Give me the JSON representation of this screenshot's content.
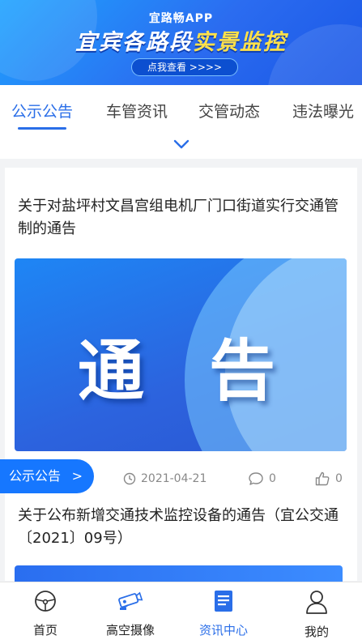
{
  "banner": {
    "app_name": "宜路畅APP",
    "title_prefix": "宜宾各路段",
    "title_highlight": "实景监控",
    "button_label": "点我查看 >>>>"
  },
  "tabs": [
    {
      "label": "公示公告",
      "active": true
    },
    {
      "label": "车管资讯",
      "active": false
    },
    {
      "label": "交管动态",
      "active": false
    },
    {
      "label": "违法曝光",
      "active": false
    }
  ],
  "articles": [
    {
      "title": "关于对盐坪村文昌宫组电机厂门口街道实行交通管制的通告",
      "image_text": [
        "通",
        "告"
      ],
      "date": "2021-04-21",
      "comments": "0",
      "likes": "0"
    },
    {
      "title": "关于公布新增交通技术监控设备的通告（宜公交通〔2021〕09号）"
    }
  ],
  "category_pill": {
    "label": "公示公告",
    "chevron": ">"
  },
  "bottom_nav": [
    {
      "label": "首页",
      "icon": "steering-wheel-icon",
      "active": false
    },
    {
      "label": "高空摄像",
      "icon": "camera-icon",
      "active": false
    },
    {
      "label": "资讯中心",
      "icon": "document-icon",
      "active": true
    },
    {
      "label": "我的",
      "icon": "user-icon",
      "active": false
    }
  ],
  "colors": {
    "accent": "#2a6ee8",
    "pill": "#1677ff",
    "highlight": "#ffe14a"
  }
}
